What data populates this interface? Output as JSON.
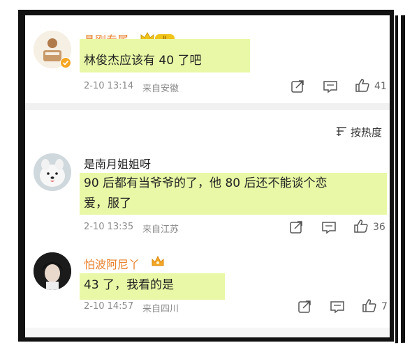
{
  "comments": [
    {
      "username": "晶刚专属",
      "text": "林俊杰应该有 40 了吧",
      "time": "2-10 13:14",
      "source": "来自安徽",
      "likes": "41"
    },
    {
      "username": "是南月姐姐呀",
      "text_line1": "90 后都有当爷爷的了，他 80 后还不能谈个恋",
      "text_line2": "爱，服了",
      "time": "2-10 13:35",
      "source": "来自江苏",
      "likes": "36"
    },
    {
      "username": "怕波阿尼丫",
      "text": "43 了，我看的是",
      "time": "2-10 14:57",
      "source": "来自四川",
      "likes": "7"
    }
  ],
  "sort_label": "按热度",
  "icons": [
    "share-icon",
    "comment-icon",
    "like-icon",
    "sort-icon",
    "vip-crown-icon",
    "verified-badge-icon"
  ],
  "colors": {
    "username": "#e8802b",
    "highlight": "#e8f8a6",
    "meta": "#8a8a8a"
  }
}
